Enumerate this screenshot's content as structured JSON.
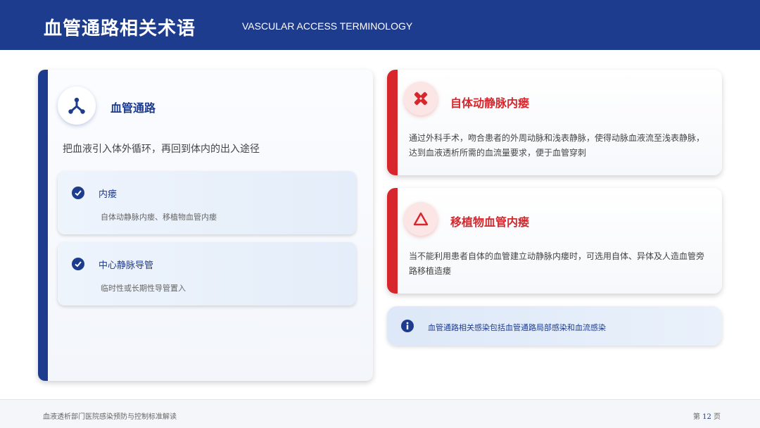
{
  "header": {
    "title": "血管通路相关术语",
    "subtitle": "VASCULAR ACCESS TERMINOLOGY"
  },
  "left_card": {
    "icon": "network-branch-icon",
    "title": "血管通路",
    "description": "把血液引入体外循环，再回到体内的出入途径",
    "items": [
      {
        "icon": "check-circle-icon",
        "title": "内瘘",
        "text": "自体动静脉内瘘、移植物血管内瘘"
      },
      {
        "icon": "check-circle-icon",
        "title": "中心静脉导管",
        "text": "临时性或长期性导管置入"
      }
    ]
  },
  "right_cards": [
    {
      "icon": "bandage-icon",
      "title": "自体动静脉内瘘",
      "text": "通过外科手术，吻合患者的外周动脉和浅表静脉，使得动脉血液流至浅表静脉，达到血液透析所需的血流量要求，便于血管穿刺"
    },
    {
      "icon": "warning-triangle-icon",
      "title": "移植物血管内瘘",
      "text": "当不能利用患者自体的血管建立动静脉内瘘时，可选用自体、异体及人造血管旁路移植造瘘"
    }
  ],
  "info": {
    "icon": "info-icon",
    "text": "血管通路相关感染包括血管通路局部感染和血流感染"
  },
  "footer": {
    "left": "血液透析部门医院感染预防与控制标准解读",
    "page_prefix": "第",
    "page_number": "12",
    "page_suffix": "页"
  },
  "colors": {
    "primary": "#1e3c8e",
    "accent": "#d7262c"
  }
}
